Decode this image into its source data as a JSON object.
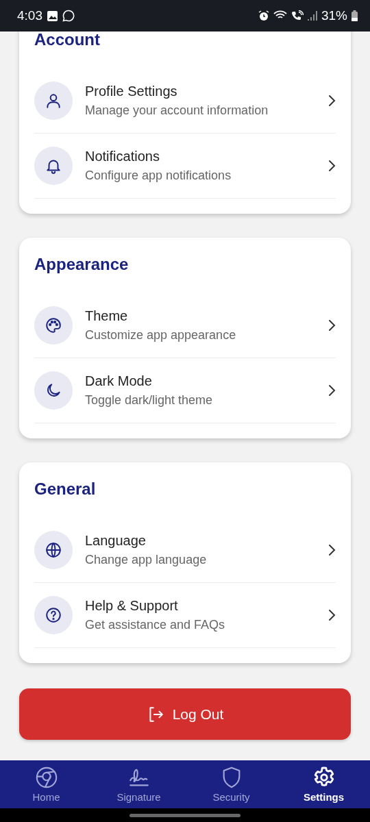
{
  "status_bar": {
    "time": "4:03",
    "battery": "31%"
  },
  "sections": [
    {
      "title": "Account",
      "items": [
        {
          "title": "Profile Settings",
          "subtitle": "Manage your account information"
        },
        {
          "title": "Notifications",
          "subtitle": "Configure app notifications"
        }
      ]
    },
    {
      "title": "Appearance",
      "items": [
        {
          "title": "Theme",
          "subtitle": "Customize app appearance"
        },
        {
          "title": "Dark Mode",
          "subtitle": "Toggle dark/light theme"
        }
      ]
    },
    {
      "title": "General",
      "items": [
        {
          "title": "Language",
          "subtitle": "Change app language"
        },
        {
          "title": "Help & Support",
          "subtitle": "Get assistance and FAQs"
        }
      ]
    }
  ],
  "logout": {
    "label": "Log Out"
  },
  "bottom_nav": [
    {
      "label": "Home",
      "selected": false
    },
    {
      "label": "Signature",
      "selected": false
    },
    {
      "label": "Security",
      "selected": false
    },
    {
      "label": "Settings",
      "selected": true
    }
  ]
}
